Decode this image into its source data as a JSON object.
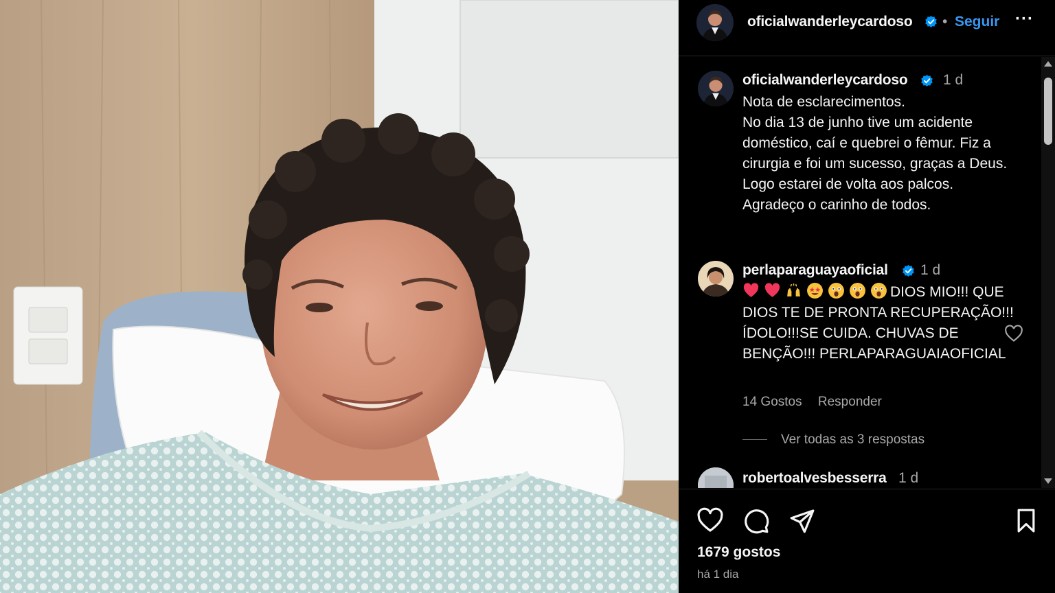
{
  "colors": {
    "background": "#000000",
    "text": "#f5f5f5",
    "secondary_text": "#a8a8a8",
    "link_blue": "#3797f0",
    "verified_blue": "#0095f6"
  },
  "post": {
    "image_icon": "hospital-selfie-photo"
  },
  "header": {
    "username": "oficialwanderleycardoso",
    "separator": "•",
    "follow_label": "Seguir",
    "more_label": "···"
  },
  "caption": {
    "username": "oficialwanderleycardoso",
    "time": "1 d",
    "lines": [
      "Nota de esclarecimentos.",
      "No dia 13 de junho tive um acidente doméstico, caí e quebrei o fêmur. Fiz a cirurgia e foi um sucesso, graças a Deus.",
      "Logo estarei de volta aos palcos.",
      "Agradeço o carinho de todos."
    ]
  },
  "comments": [
    {
      "username": "perlaparaguayaoficial",
      "time": "1 d",
      "emojis": [
        "red-heart-icon",
        "red-heart-icon",
        "raised-hands-icon",
        "star-struck-icon",
        "astonished-face-icon",
        "astonished-face-icon",
        "astonished-face-icon"
      ],
      "text_after_emojis": "DIOS MIO!!! QUE DIOS TE DE PRONTA RECUPERAÇÃO!!! ÍDOLO!!!SE CUIDA. CHUVAS DE BENÇÃO!!! PERLAPARAGUAIAOFICIAL",
      "likes_label": "14 Gostos",
      "reply_label": "Responder",
      "view_replies_label": "Ver todas as 3 respostas"
    },
    {
      "username": "robertoalvesbesserra",
      "time": "1 d"
    }
  ],
  "actions": {
    "like_icon": "heart-outline-icon",
    "comment_icon": "comment-bubble-icon",
    "share_icon": "paper-plane-icon",
    "save_icon": "bookmark-icon",
    "likes_count": "1679 gostos",
    "posted_when": "há 1 dia"
  }
}
